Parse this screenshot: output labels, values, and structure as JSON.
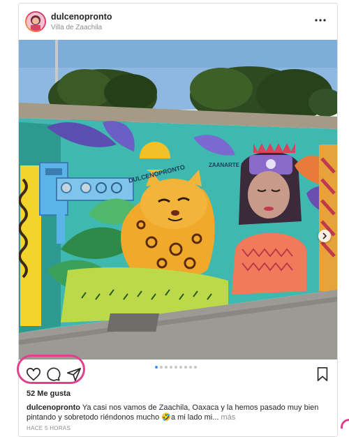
{
  "post": {
    "username": "dulcenopronto",
    "location": "Villa de Zaachila",
    "likes": "52 Me gusta",
    "caption_user": "dulcenopronto",
    "caption_text": " Ya casi nos vamos de Zaachila, Oaxaca y la hemos pasado muy bien pintando y sobretodo riéndonos mucho 🤣a mi lado mi...",
    "caption_more": " más",
    "time": "HACE 5 HORAS"
  },
  "mural": {
    "signature": "DULCENOPRONTO",
    "signature2": "ZAANARTE 2022"
  },
  "carousel": {
    "count": 9,
    "active": 0
  },
  "colors": {
    "highlight": "#e0418f",
    "active_dot": "#3897f0",
    "accent_text": "#262626"
  },
  "icons": [
    "more-options-icon",
    "next-arrow-icon",
    "heart-icon",
    "comment-icon",
    "share-icon",
    "bookmark-icon"
  ]
}
